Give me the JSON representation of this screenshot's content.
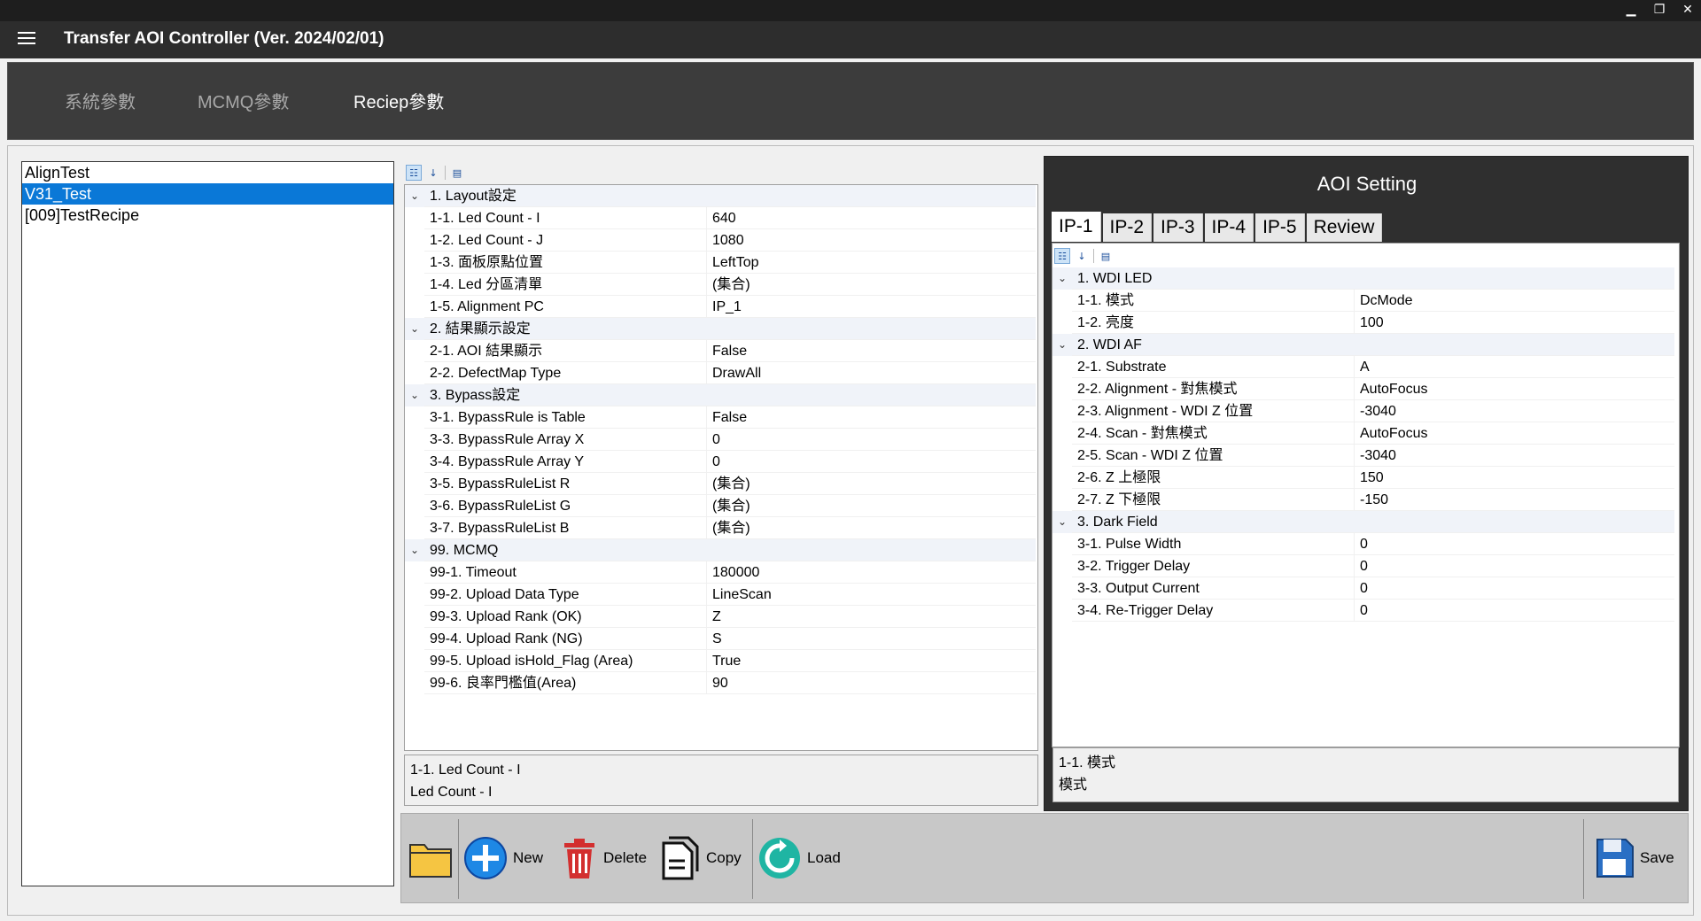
{
  "window": {
    "minimize": "▁",
    "restore": "❐",
    "close": "✕"
  },
  "app": {
    "title": "Transfer AOI Controller (Ver. 2024/02/01)"
  },
  "nav": {
    "tabs": [
      {
        "label": "系統參數"
      },
      {
        "label": "MCMQ參數"
      },
      {
        "label": "Reciep參數"
      }
    ],
    "active": "Reciep參數"
  },
  "recipes": {
    "items": [
      "AlignTest",
      "V31_Test",
      "[009]TestRecipe"
    ],
    "selected": "V31_Test"
  },
  "recipe_grid": {
    "rows": [
      {
        "type": "cat",
        "name": "1.  Layout設定"
      },
      {
        "name": "1-1.  Led Count - I",
        "value": "640"
      },
      {
        "name": "1-2.  Led Count - J",
        "value": "1080"
      },
      {
        "name": "1-3.  面板原點位置",
        "value": "LeftTop"
      },
      {
        "name": "1-4.  Led 分區清單",
        "value": "(集合)"
      },
      {
        "name": "1-5.  Alignment PC",
        "value": "IP_1"
      },
      {
        "type": "cat",
        "name": "2.  結果顯示設定"
      },
      {
        "name": "2-1.  AOI 結果顯示",
        "value": "False"
      },
      {
        "name": "2-2.  DefectMap Type",
        "value": "DrawAll"
      },
      {
        "type": "cat",
        "name": "3.  Bypass設定"
      },
      {
        "name": "3-1.  BypassRule is Table",
        "value": "False"
      },
      {
        "name": "3-3.  BypassRule Array X",
        "value": "0"
      },
      {
        "name": "3-4.  BypassRule Array Y",
        "value": "0"
      },
      {
        "name": "3-5.  BypassRuleList R",
        "value": "(集合)"
      },
      {
        "name": "3-6.  BypassRuleList G",
        "value": "(集合)"
      },
      {
        "name": "3-7.  BypassRuleList B",
        "value": "(集合)"
      },
      {
        "type": "cat",
        "name": "99.  MCMQ"
      },
      {
        "name": "99-1.  Timeout",
        "value": "180000"
      },
      {
        "name": "99-2.  Upload Data Type",
        "value": "LineScan"
      },
      {
        "name": "99-3.  Upload Rank (OK)",
        "value": "Z"
      },
      {
        "name": "99-4.   Upload Rank (NG)",
        "value": "S"
      },
      {
        "name": "99-5.  Upload isHold_Flag (Area)",
        "value": "True"
      },
      {
        "name": "99-6.  良率門檻值(Area)",
        "value": "90"
      }
    ],
    "description": {
      "title": "1-1.  Led Count - I",
      "text": "Led Count - I"
    }
  },
  "aoi": {
    "title": "AOI Setting",
    "tabs": [
      "IP-1",
      "IP-2",
      "IP-3",
      "IP-4",
      "IP-5",
      "Review"
    ],
    "active_tab": "IP-1",
    "rows": [
      {
        "type": "cat",
        "name": "1.  WDI LED"
      },
      {
        "name": "1-1.  模式",
        "value": "DcMode"
      },
      {
        "name": "1-2.  亮度",
        "value": "100"
      },
      {
        "type": "cat",
        "name": "2.  WDI AF"
      },
      {
        "name": "2-1.  Substrate",
        "value": "A"
      },
      {
        "name": "2-2.  Alignment - 對焦模式",
        "value": "AutoFocus"
      },
      {
        "name": "2-3.  Alignment - WDI Z 位置",
        "value": "-3040"
      },
      {
        "name": "2-4.  Scan - 對焦模式",
        "value": "AutoFocus"
      },
      {
        "name": "2-5.  Scan - WDI Z 位置",
        "value": "-3040"
      },
      {
        "name": "2-6.  Z 上極限",
        "value": "150"
      },
      {
        "name": "2-7.  Z 下極限",
        "value": "-150"
      },
      {
        "type": "cat",
        "name": "3.  Dark Field"
      },
      {
        "name": "3-1.  Pulse Width",
        "value": "0"
      },
      {
        "name": "3-2.  Trigger Delay",
        "value": "0"
      },
      {
        "name": "3-3.  Output Current",
        "value": "0"
      },
      {
        "name": "3-4.  Re-Trigger Delay",
        "value": "0"
      }
    ],
    "description": {
      "title": "1-1.  模式",
      "text": "模式"
    }
  },
  "toolbar": {
    "new": "New",
    "delete": "Delete",
    "copy": "Copy",
    "load": "Load",
    "save": "Save"
  },
  "icons": {
    "folder": "folder-icon",
    "new": "plus-circle-icon",
    "delete": "trash-icon",
    "copy": "copy-icon",
    "load": "refresh-icon",
    "save": "floppy-icon"
  }
}
